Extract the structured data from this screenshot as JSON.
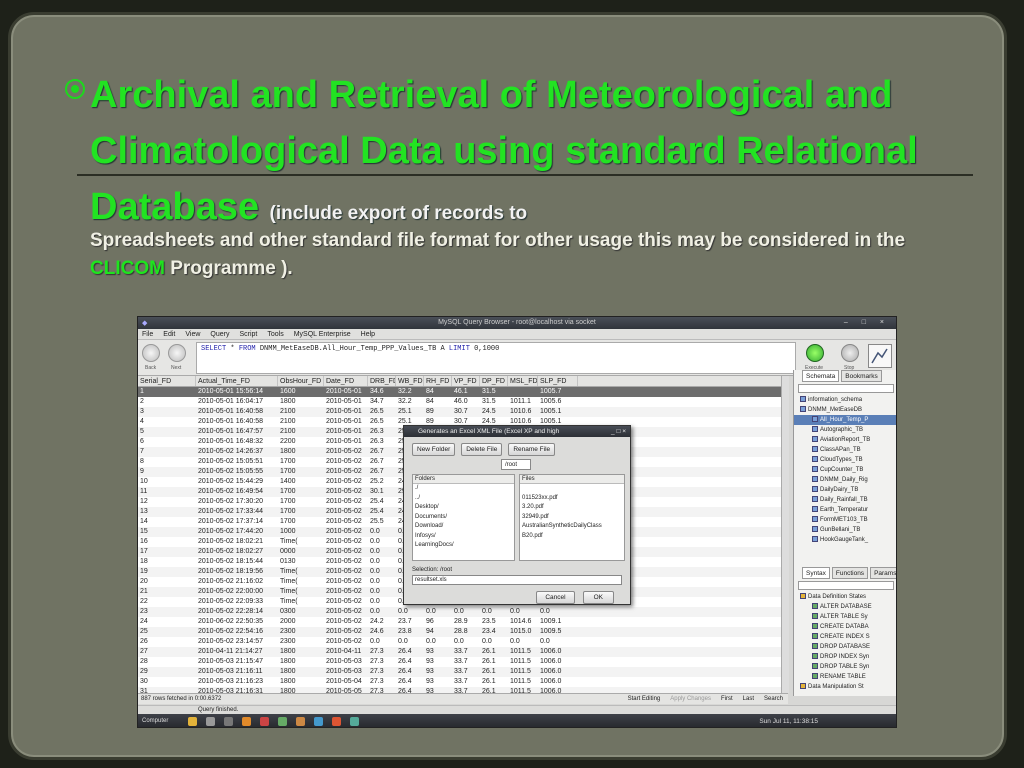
{
  "slide": {
    "title": "Archival and Retrieval of Meteorological and Climatological Data using standard Relational Database",
    "sub_open": "(",
    "sub_text1": "include export of records to",
    "sub_text2": "Spreadsheets and other standard file format for other usage this may be considered in the",
    "sub_highlight": "CLICOM",
    "sub_text3": "Programme )."
  },
  "app": {
    "window_title": "MySQL Query Browser - root@localhost via socket",
    "menu": [
      "File",
      "Edit",
      "View",
      "Query",
      "Script",
      "Tools",
      "MySQL Enterprise",
      "Help"
    ],
    "nav_back": "Back",
    "nav_next": "Next",
    "execute_label": "Execute",
    "stop_label": "Stop",
    "sql_kw1": "SELECT",
    "sql_star": "*",
    "sql_kw2": "FROM",
    "sql_table": "DNMM_MetEaseDB.All_Hour_Temp_PPP_Values_TB A",
    "sql_kw3": "LIMIT",
    "sql_limit": "0,1000",
    "columns": [
      "Serial_FD",
      "Actual_Time_FD",
      "ObsHour_FD",
      "Date_FD",
      "DRB_FD",
      "WB_FD",
      "RH_FD",
      "VP_FD",
      "DP_FD",
      "MSL_FD",
      "SLP_FD"
    ],
    "rows": [
      [
        "1",
        "2010-05-01 15:56:14",
        "1600",
        "2010-05-01",
        "34.6",
        "32.2",
        "84",
        "46.1",
        "31.5",
        "",
        "1005.7"
      ],
      [
        "2",
        "2010-05-01 16:04:17",
        "1800",
        "2010-05-01",
        "34.7",
        "32.2",
        "84",
        "46.0",
        "31.5",
        "1011.1",
        "1005.6"
      ],
      [
        "3",
        "2010-05-01 16:40:58",
        "2100",
        "2010-05-01",
        "26.5",
        "25.1",
        "89",
        "30.7",
        "24.5",
        "1010.6",
        "1005.1"
      ],
      [
        "4",
        "2010-05-01 16:40:58",
        "2100",
        "2010-05-01",
        "26.5",
        "25.1",
        "89",
        "30.7",
        "24.5",
        "1010.6",
        "1005.1"
      ],
      [
        "5",
        "2010-05-01 16:47:57",
        "2100",
        "2010-05-01",
        "26.3",
        "25.2",
        "",
        "",
        "",
        "",
        ""
      ],
      [
        "6",
        "2010-05-01 16:48:32",
        "2200",
        "2010-05-01",
        "26.3",
        "25.2",
        "",
        "",
        "",
        "",
        ""
      ],
      [
        "7",
        "2010-05-02 14:26:37",
        "1800",
        "2010-05-02",
        "26.7",
        "25.3",
        "",
        "",
        "",
        "",
        ""
      ],
      [
        "8",
        "2010-05-02 15:05:51",
        "1700",
        "2010-05-02",
        "26.7",
        "25.3",
        "",
        "",
        "",
        "",
        ""
      ],
      [
        "9",
        "2010-05-02 15:05:55",
        "1700",
        "2010-05-02",
        "26.7",
        "25.3",
        "",
        "",
        "",
        "",
        ""
      ],
      [
        "10",
        "2010-05-02 15:44:29",
        "1400",
        "2010-05-02",
        "25.2",
        "24.3",
        "",
        "",
        "",
        "",
        ""
      ],
      [
        "11",
        "2010-05-02 16:49:54",
        "1700",
        "2010-05-02",
        "30.1",
        "29.3",
        "",
        "",
        "",
        "",
        ""
      ],
      [
        "12",
        "2010-05-02 17:30:20",
        "1700",
        "2010-05-02",
        "25.4",
        "24.6",
        "",
        "",
        "",
        "",
        ""
      ],
      [
        "13",
        "2010-05-02 17:33:44",
        "1700",
        "2010-05-02",
        "25.4",
        "24.6",
        "",
        "",
        "",
        "",
        ""
      ],
      [
        "14",
        "2010-05-02 17:37:14",
        "1700",
        "2010-05-02",
        "25.5",
        "24.7",
        "",
        "",
        "",
        "",
        ""
      ],
      [
        "15",
        "2010-05-02 17:44:20",
        "1000",
        "2010-05-02",
        "0.0",
        "0.0",
        "",
        "",
        "",
        "",
        ""
      ],
      [
        "16",
        "2010-05-02 18:02:21",
        "Time(",
        "2010-05-02",
        "0.0",
        "0.0",
        "",
        "",
        "",
        "",
        ""
      ],
      [
        "17",
        "2010-05-02 18:02:27",
        "0000",
        "2010-05-02",
        "0.0",
        "0.0",
        "",
        "",
        "",
        "",
        ""
      ],
      [
        "18",
        "2010-05-02 18:15:44",
        "0130",
        "2010-05-02",
        "0.0",
        "0.0",
        "",
        "",
        "",
        "",
        ""
      ],
      [
        "19",
        "2010-05-02 18:19:56",
        "Time(",
        "2010-05-02",
        "0.0",
        "0.0",
        "",
        "",
        "",
        "",
        ""
      ],
      [
        "20",
        "2010-05-02 21:16:02",
        "Time(",
        "2010-05-02",
        "0.0",
        "0.0",
        "",
        "",
        "",
        "",
        ""
      ],
      [
        "21",
        "2010-05-02 22:00:00",
        "Time(",
        "2010-05-02",
        "0.0",
        "0.0",
        "",
        "",
        "",
        "",
        ""
      ],
      [
        "22",
        "2010-05-02 22:09:33",
        "Time(",
        "2010-05-02",
        "0.0",
        "0.0",
        "",
        "",
        "",
        "",
        ""
      ],
      [
        "23",
        "2010-05-02 22:28:14",
        "0300",
        "2010-05-02",
        "0.0",
        "0.0",
        "0.0",
        "0.0",
        "0.0",
        "0.0",
        "0.0"
      ],
      [
        "24",
        "2010-06-02 22:50:35",
        "2000",
        "2010-05-02",
        "24.2",
        "23.7",
        "96",
        "28.9",
        "23.5",
        "1014.6",
        "1009.1"
      ],
      [
        "25",
        "2010-05-02 22:54:16",
        "2300",
        "2010-05-02",
        "24.6",
        "23.8",
        "94",
        "28.8",
        "23.4",
        "1015.0",
        "1009.5"
      ],
      [
        "26",
        "2010-05-02 23:14:57",
        "2300",
        "2010-05-02",
        "0.0",
        "0.0",
        "0.0",
        "0.0",
        "0.0",
        "0.0",
        "0.0"
      ],
      [
        "27",
        "2010-04-11 21:14:27",
        "1800",
        "2010-04-11",
        "27.3",
        "26.4",
        "93",
        "33.7",
        "26.1",
        "1011.5",
        "1006.0"
      ],
      [
        "28",
        "2010-05-03 21:15:47",
        "1800",
        "2010-05-03",
        "27.3",
        "26.4",
        "93",
        "33.7",
        "26.1",
        "1011.5",
        "1006.0"
      ],
      [
        "29",
        "2010-05-03 21:16:11",
        "1800",
        "2010-05-03",
        "27.3",
        "26.4",
        "93",
        "33.7",
        "26.1",
        "1011.5",
        "1006.0"
      ],
      [
        "30",
        "2010-05-03 21:16:23",
        "1800",
        "2010-05-04",
        "27.3",
        "26.4",
        "93",
        "33.7",
        "26.1",
        "1011.5",
        "1006.0"
      ],
      [
        "31",
        "2010-05-03 21:16:31",
        "1800",
        "2010-05-05",
        "27.3",
        "26.4",
        "93",
        "33.7",
        "26.1",
        "1011.5",
        "1006.0"
      ]
    ],
    "rows_fetched": "887 rows fetched in 0:00.6372",
    "status_btns": [
      "Start Editing",
      "Apply Changes",
      "First",
      "Last",
      "Search"
    ],
    "query_status": "Query finished.",
    "right_tabs": [
      "Schemata",
      "Bookmarks"
    ],
    "schema_items": [
      "information_schema",
      "DNMM_MetEaseDB",
      "All_Hour_Temp_P",
      "Autographic_TB",
      "AviationReport_TB",
      "ClassAPan_TB",
      "CloudTypes_TB",
      "CupCounter_TB",
      "DNMM_Daily_Rig",
      "DailyDairy_TB",
      "Daily_Rainfall_TB",
      "Earth_Temperatur",
      "FormMET103_TB",
      "GunBellani_TB",
      "HookGaugeTank_"
    ],
    "syntax_tabs": [
      "Syntax",
      "Functions",
      "Params",
      "Tr"
    ],
    "syntax_items": [
      "Data Definition States",
      "ALTER DATABASE",
      "ALTER TABLE Sy",
      "CREATE DATABA",
      "CREATE INDEX S",
      "DROP DATABASE",
      "DROP INDEX Syn",
      "DROP TABLE Syn",
      "RENAME TABLE",
      "Data Manipulation St"
    ],
    "taskbar_start": "Computer",
    "clock": "Sun Jul 11, 11:38:15"
  },
  "dialog": {
    "title": "Generates an Excel XML File (Excel XP and high",
    "btn_new": "New Folder",
    "btn_delete": "Delete File",
    "btn_rename": "Rename File",
    "path": "/root",
    "folders_header": "Folders",
    "folders": [
      "./",
      "../",
      "Desktop/",
      "Documents/",
      "Download/",
      "Infosys/",
      "LearningDocs/"
    ],
    "files_header": "Files",
    "files": [
      "",
      "011523xx.pdf",
      "3.20.pdf",
      "32949.pdf",
      "AustralianSyntheticDailyClass",
      "B20.pdf"
    ],
    "selection_label": "Selection: /root",
    "selection_value": "resultset.xls",
    "cancel": "Cancel",
    "ok": "OK"
  }
}
